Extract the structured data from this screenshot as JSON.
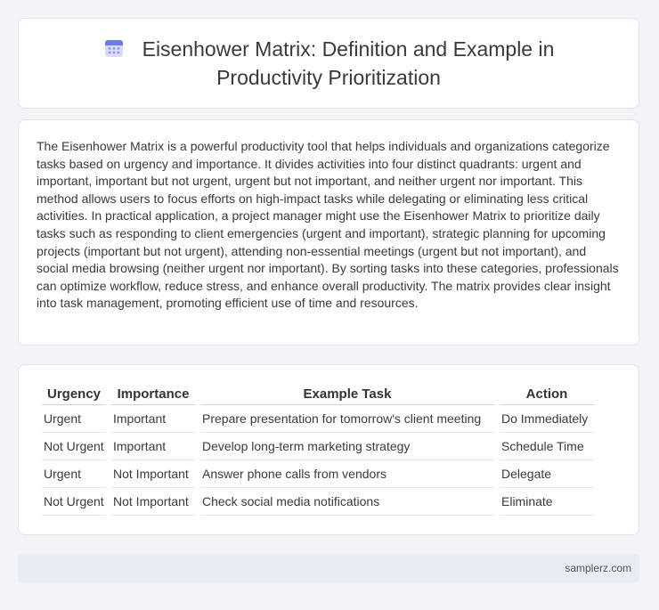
{
  "header": {
    "title": "Eisenhower Matrix: Definition and Example in Productivity Prioritization",
    "icon": "calendar-icon"
  },
  "description": "The Eisenhower Matrix is a powerful productivity tool that helps individuals and organizations categorize tasks based on urgency and importance. It divides activities into four distinct quadrants: urgent and important, important but not urgent, urgent but not important, and neither urgent nor important. This method allows users to focus efforts on high-impact tasks while delegating or eliminating less critical activities. In practical application, a project manager might use the Eisenhower Matrix to prioritize daily tasks such as responding to client emergencies (urgent and important), strategic planning for upcoming projects (important but not urgent), attending non-essential meetings (urgent but not important), and social media browsing (neither urgent nor important). By sorting tasks into these categories, professionals can optimize workflow, reduce stress, and enhance overall productivity. The matrix provides clear insight into task management, promoting efficient use of time and resources.",
  "table": {
    "headers": [
      "Urgency",
      "Importance",
      "Example Task",
      "Action"
    ],
    "rows": [
      [
        "Urgent",
        "Important",
        "Prepare presentation for tomorrow's client meeting",
        "Do Immediately"
      ],
      [
        "Not Urgent",
        "Important",
        "Develop long-term marketing strategy",
        "Schedule Time"
      ],
      [
        "Urgent",
        "Not Important",
        "Answer phone calls from vendors",
        "Delegate"
      ],
      [
        "Not Urgent",
        "Not Important",
        "Check social media notifications",
        "Eliminate"
      ]
    ]
  },
  "footer": {
    "site": "samplerz.com"
  }
}
